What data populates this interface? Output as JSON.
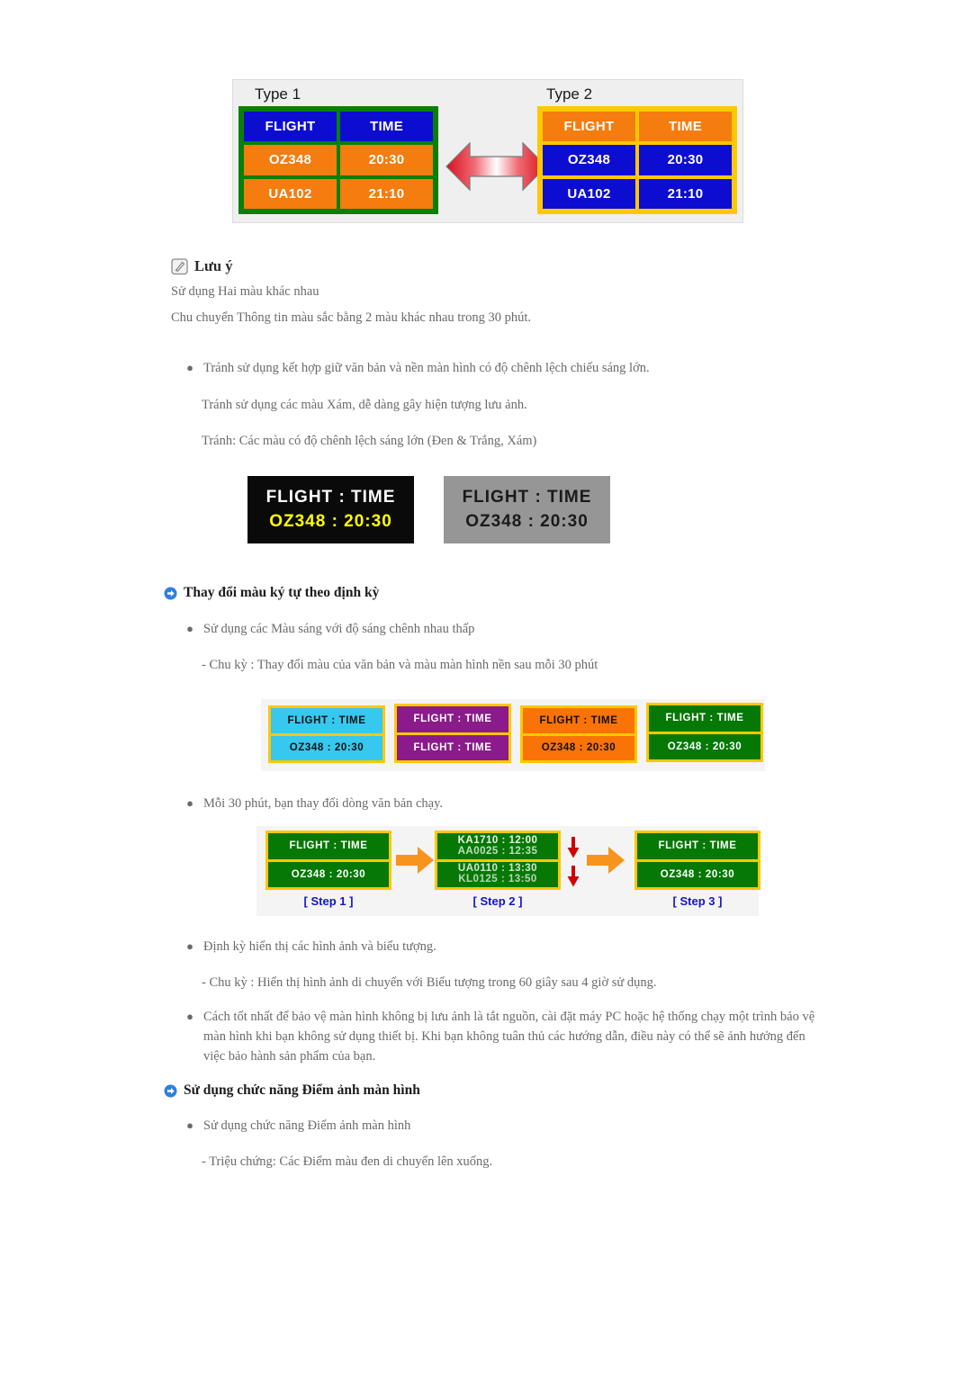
{
  "figure_top": {
    "type1_label": "Type 1",
    "type2_label": "Type 2",
    "type1": {
      "border_color": "#087f08",
      "rows": [
        {
          "cells": [
            "FLIGHT",
            "TIME"
          ],
          "bg": "#0d0dd2",
          "fg": "#ffffff"
        },
        {
          "cells": [
            "OZ348",
            "20:30"
          ],
          "bg": "#f57c0f",
          "fg": "#ffffff"
        },
        {
          "cells": [
            "UA102",
            "21:10"
          ],
          "bg": "#f57c0f",
          "fg": "#ffffff"
        }
      ]
    },
    "type2": {
      "border_color": "#ffc800",
      "rows": [
        {
          "cells": [
            "FLIGHT",
            "TIME"
          ],
          "bg": "#f57c0f",
          "fg": "#ffffff"
        },
        {
          "cells": [
            "OZ348",
            "20:30"
          ],
          "bg": "#0d0dd2",
          "fg": "#ffffff"
        },
        {
          "cells": [
            "UA102",
            "21:10"
          ],
          "bg": "#0d0dd2",
          "fg": "#ffffff"
        }
      ]
    },
    "arrow_icon": "double-arrow-horizontal",
    "arrow_color": "#e01b24"
  },
  "note": {
    "icon": "note-pencil-icon",
    "title": "Lưu ý",
    "lines": [
      "Sử dụng Hai màu khác nhau",
      "Chu chuyển Thông tin màu sắc bằng 2 màu khác nhau trong 30 phút."
    ]
  },
  "avoid_bullets": {
    "bullet1": "Tránh sử dụng kết hợp giữ văn bản và nền màn hình có độ chênh lệch chiếu sáng lớn.",
    "line2": "Tránh sử dụng các màu Xám, dễ dàng gây hiện tượng lưu ảnh.",
    "line3": "Tránh: Các màu có độ chênh lệch sáng lớn (Đen & Trắng, Xám)"
  },
  "contrast_panels": [
    {
      "name": "black-panel",
      "bg": "#0a0a0a",
      "line1": "FLIGHT : TIME",
      "line1_color": "#ffffff",
      "line2": "OZ348  :  20:30",
      "line2_color": "#ffff00"
    },
    {
      "name": "gray-panel",
      "bg": "#969696",
      "line1": "FLIGHT : TIME",
      "line1_color": "#1a1a1a",
      "line2": "OZ348  :  20:30",
      "line2_color": "#1a1a1a"
    }
  ],
  "section_color_cycle": {
    "icon": "blue-arrow-circle-icon",
    "heading": "Thay đổi màu ký tự theo định kỳ",
    "bullet1": "Sử dụng các Màu sáng với độ sáng chênh nhau thấp",
    "sub1": "- Chu kỳ : Thay đổi màu của văn bản và màu màn hình nền sau mỗi 30 phút",
    "bullet2": "Mỗi 30 phút, bạn thay đổi dòng văn bản chạy.",
    "bullet3": "Định kỳ hiển thị các hình ảnh và biểu tượng.",
    "sub3": "- Chu kỳ : Hiển thị hình ảnh di chuyển với Biểu tượng trong 60 giây sau 4 giờ sử dụng.",
    "bullet4": "Cách tốt nhất để bảo vệ màn hình không bị lưu ảnh là tắt nguồn, cài đặt máy PC hoặc hệ thống chạy một trình bảo vệ màn hình khi bạn không sử dụng thiết bị. Khi bạn không tuân thủ các hướng dẫn, điều này có thể sẽ ảnh hưởng đến việc bảo hành sản phẩm của bạn."
  },
  "color_strip": {
    "border_color": "#ffc800",
    "panels": [
      {
        "name": "cyan-panel",
        "bg": "#36c8ee",
        "fg": "#111111",
        "row1": "FLIGHT : TIME",
        "row2": "OZ348   :  20:30"
      },
      {
        "name": "purple-panel",
        "bg": "#8b1a8b",
        "fg": "#ffffff",
        "row1": "FLIGHT : TIME",
        "row2": "FLIGHT : TIME"
      },
      {
        "name": "orange-panel",
        "bg": "#f97306",
        "fg": "#111111",
        "row1": "FLIGHT : TIME",
        "row2": "OZ348   :  20:30"
      },
      {
        "name": "green-panel",
        "bg": "#067806",
        "fg": "#ffffff",
        "row1": "FLIGHT : TIME",
        "row2": "OZ348   :  20:30"
      }
    ]
  },
  "steps_figure": {
    "border_color": "#ffc800",
    "panel_bg": "#067806",
    "arrow_color": "#f7941e",
    "scroll_arrow_color": "#cc0000",
    "step1": {
      "label": "[ Step 1 ]",
      "row1": "FLIGHT : TIME",
      "row2": "OZ348   :  20:30"
    },
    "step2": {
      "label": "[ Step 2 ]",
      "row1_top": "KA1710 : 12:00",
      "row1_bottom": "AA0025 : 12:35",
      "row2_top": "UA0110 : 13:30",
      "row2_bottom": "KL0125 : 13:50"
    },
    "step3": {
      "label": "[ Step 3 ]",
      "row1": "FLIGHT : TIME",
      "row2": "OZ348   :  20:30"
    }
  },
  "section_pixel_shift": {
    "icon": "blue-arrow-circle-icon",
    "heading": "Sử dụng chức năng Điểm ảnh màn hình",
    "bullet1": "Sử dụng chức năng Điểm ảnh màn hình",
    "sub1": "- Triệu chứng: Các Điểm màu đen di chuyển lên xuống."
  }
}
